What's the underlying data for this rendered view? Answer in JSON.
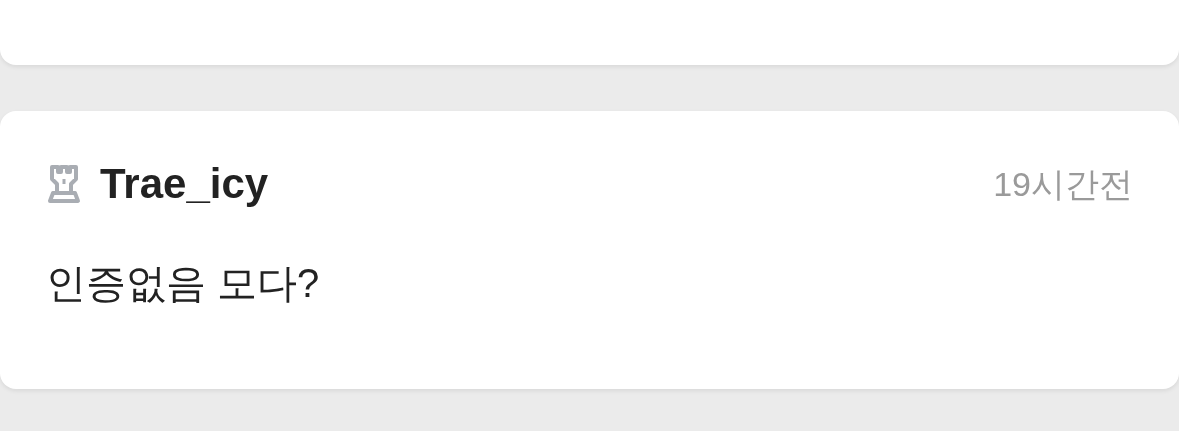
{
  "comments": [
    {
      "kind": "empty"
    },
    {
      "kind": "comment",
      "author": "Trae_icy",
      "time": "19시간전",
      "text": "인증없음 모다?"
    }
  ]
}
